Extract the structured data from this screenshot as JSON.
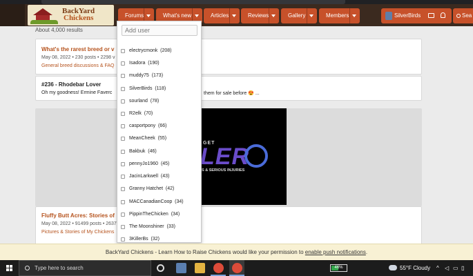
{
  "browser": {
    "url": "backyardchickens.com/search/query?..."
  },
  "header": {
    "logo_line1": "BackYard",
    "logo_line2": "Chickens",
    "nav": [
      {
        "label": "Forums"
      },
      {
        "label": "What's new"
      },
      {
        "label": "Articles"
      },
      {
        "label": "Reviews"
      },
      {
        "label": "Gallery"
      },
      {
        "label": "Members"
      }
    ],
    "username": "SilverBirds",
    "search_label": "Sea"
  },
  "results": {
    "count": "About 4,000 results",
    "items": [
      {
        "title": "What's the rarest breed or v",
        "meta": "May 08, 2022 • 230 posts • 2298 v",
        "forum": "General breed discussions & FAQ"
      },
      {
        "post_no": "#236",
        "post_title": "Rhodebar Lover",
        "text_left": "Oh my goodness! Ermine Faverc",
        "text_right": "them for sale before 😍 ..."
      },
      {
        "title": "Fluffy Butt Acres: Stories of",
        "meta": "May 08, 2022 • 91499 posts • 2637",
        "forum": "Pictures & Stories of My Chickens"
      }
    ]
  },
  "ad": {
    "top_word": "GET",
    "big_word": "LER",
    "tagline": "S & SERIOUS INJURIES"
  },
  "user_filter": {
    "placeholder": "Add user",
    "users": [
      {
        "name": "electrycmonk",
        "count": "(208)"
      },
      {
        "name": "Isadora",
        "count": "(190)"
      },
      {
        "name": "muddy75",
        "count": "(173)"
      },
      {
        "name": "SilverBirds",
        "count": "(118)"
      },
      {
        "name": "sourland",
        "count": "(78)"
      },
      {
        "name": "R2elk",
        "count": "(70)"
      },
      {
        "name": "casportpony",
        "count": "(66)"
      },
      {
        "name": "MeanCheek",
        "count": "(55)"
      },
      {
        "name": "Bakbuk",
        "count": "(46)"
      },
      {
        "name": "pennyJo1960",
        "count": "(45)"
      },
      {
        "name": "JacinLarkwell",
        "count": "(43)"
      },
      {
        "name": "Granny Hatchet",
        "count": "(42)"
      },
      {
        "name": "MACCanadianCoop",
        "count": "(34)"
      },
      {
        "name": "PippinTheChicken",
        "count": "(34)"
      },
      {
        "name": "The Moonshiner",
        "count": "(33)"
      },
      {
        "name": "3KillerBs",
        "count": "(32)"
      }
    ]
  },
  "push_bar": {
    "text": "BackYard Chickens - Learn How to Raise Chickens would like your permission to ",
    "link": "enable push notifications",
    "end": "."
  },
  "taskbar": {
    "search_placeholder": "Type here to search",
    "battery": "46%",
    "battery_level": 0.46,
    "weather": "55°F  Cloudy"
  },
  "colors": {
    "brand_orange": "#c7512a",
    "link_orange": "#b5521c",
    "header_brown": "#3b2a1f",
    "push_bar_bg": "#f8f1d4"
  },
  "icons": [
    "search-icon",
    "mail-icon",
    "bell-icon",
    "chevron-down-icon",
    "windows-start-icon",
    "chrome-icon",
    "battery-icon",
    "cloud-icon"
  ]
}
